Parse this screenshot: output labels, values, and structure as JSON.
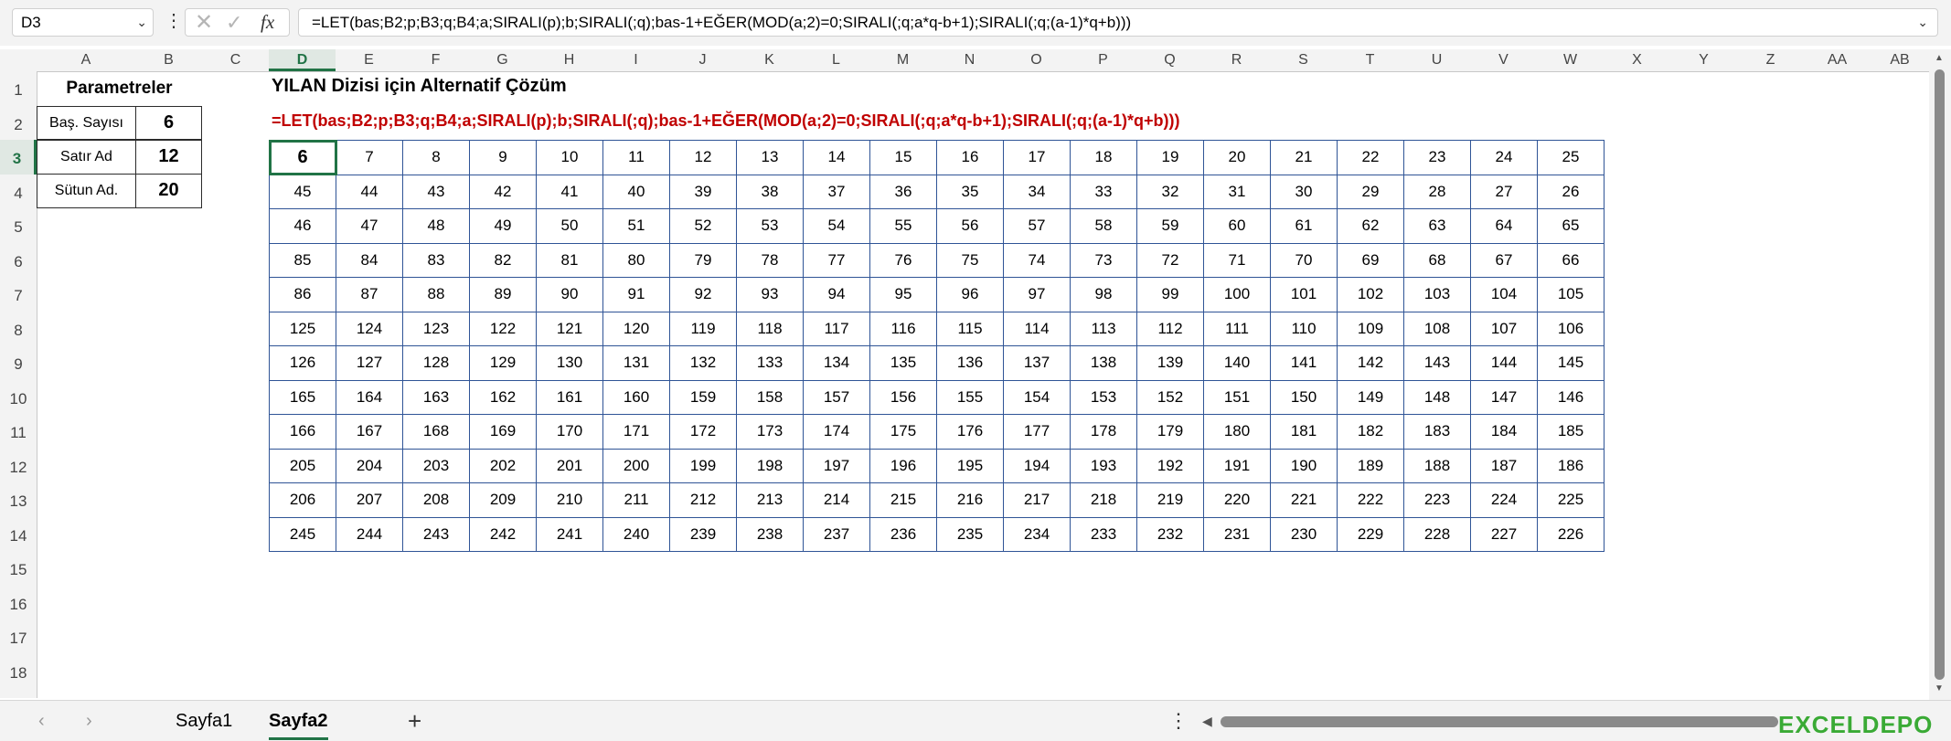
{
  "formula_bar": {
    "name_box": "D3",
    "fx_label": "fx",
    "formula": "=LET(bas;B2;p;B3;q;B4;a;SIRALI(p);b;SIRALI(;q);bas-1+EĞER(MOD(a;2)=0;SIRALI(;q;a*q-b+1);SIRALI(;q;(a-1)*q+b)))"
  },
  "column_headers": [
    "A",
    "B",
    "C",
    "D",
    "E",
    "F",
    "G",
    "H",
    "I",
    "J",
    "K",
    "L",
    "M",
    "N",
    "O",
    "P",
    "Q",
    "R",
    "S",
    "T",
    "U",
    "V",
    "W",
    "X",
    "Y",
    "Z",
    "AA",
    "AB"
  ],
  "row_headers": [
    "1",
    "2",
    "3",
    "4",
    "5",
    "6",
    "7",
    "8",
    "9",
    "10",
    "11",
    "12",
    "13",
    "14",
    "15",
    "16",
    "17",
    "18"
  ],
  "selected_cell": {
    "column": "D",
    "row": "3"
  },
  "parameters": {
    "header": "Parametreler",
    "rows": [
      {
        "label": "Baş. Sayısı",
        "value": "6"
      },
      {
        "label": "Satır Ad",
        "value": "12"
      },
      {
        "label": "Sütun Ad.",
        "value": "20"
      }
    ]
  },
  "sheet": {
    "title": "YILAN Dizisi için Alternatif Çözüm",
    "formula_text": "=LET(bas;B2;p;B3;q;B4;a;SIRALI(p);b;SIRALI(;q);bas-1+EĞER(MOD(a;2)=0;SIRALI(;q;a*q-b+1);SIRALI(;q;(a-1)*q+b)))"
  },
  "snake_grid": [
    [
      6,
      7,
      8,
      9,
      10,
      11,
      12,
      13,
      14,
      15,
      16,
      17,
      18,
      19,
      20,
      21,
      22,
      23,
      24,
      25
    ],
    [
      45,
      44,
      43,
      42,
      41,
      40,
      39,
      38,
      37,
      36,
      35,
      34,
      33,
      32,
      31,
      30,
      29,
      28,
      27,
      26
    ],
    [
      46,
      47,
      48,
      49,
      50,
      51,
      52,
      53,
      54,
      55,
      56,
      57,
      58,
      59,
      60,
      61,
      62,
      63,
      64,
      65
    ],
    [
      85,
      84,
      83,
      82,
      81,
      80,
      79,
      78,
      77,
      76,
      75,
      74,
      73,
      72,
      71,
      70,
      69,
      68,
      67,
      66
    ],
    [
      86,
      87,
      88,
      89,
      90,
      91,
      92,
      93,
      94,
      95,
      96,
      97,
      98,
      99,
      100,
      101,
      102,
      103,
      104,
      105
    ],
    [
      125,
      124,
      123,
      122,
      121,
      120,
      119,
      118,
      117,
      116,
      115,
      114,
      113,
      112,
      111,
      110,
      109,
      108,
      107,
      106
    ],
    [
      126,
      127,
      128,
      129,
      130,
      131,
      132,
      133,
      134,
      135,
      136,
      137,
      138,
      139,
      140,
      141,
      142,
      143,
      144,
      145
    ],
    [
      165,
      164,
      163,
      162,
      161,
      160,
      159,
      158,
      157,
      156,
      155,
      154,
      153,
      152,
      151,
      150,
      149,
      148,
      147,
      146
    ],
    [
      166,
      167,
      168,
      169,
      170,
      171,
      172,
      173,
      174,
      175,
      176,
      177,
      178,
      179,
      180,
      181,
      182,
      183,
      184,
      185
    ],
    [
      205,
      204,
      203,
      202,
      201,
      200,
      199,
      198,
      197,
      196,
      195,
      194,
      193,
      192,
      191,
      190,
      189,
      188,
      187,
      186
    ],
    [
      206,
      207,
      208,
      209,
      210,
      211,
      212,
      213,
      214,
      215,
      216,
      217,
      218,
      219,
      220,
      221,
      222,
      223,
      224,
      225
    ],
    [
      245,
      244,
      243,
      242,
      241,
      240,
      239,
      238,
      237,
      236,
      235,
      234,
      233,
      232,
      231,
      230,
      229,
      228,
      227,
      226
    ]
  ],
  "sheet_tabs": [
    "Sayfa1",
    "Sayfa2"
  ],
  "active_tab": "Sayfa2",
  "bottom_bar": {
    "add_sheet": "+",
    "options": "⋮",
    "logo": "EXCELDEPO"
  },
  "colors": {
    "accent": "#217346",
    "formula_red": "#c00000",
    "grid_border": "#2f5496"
  }
}
